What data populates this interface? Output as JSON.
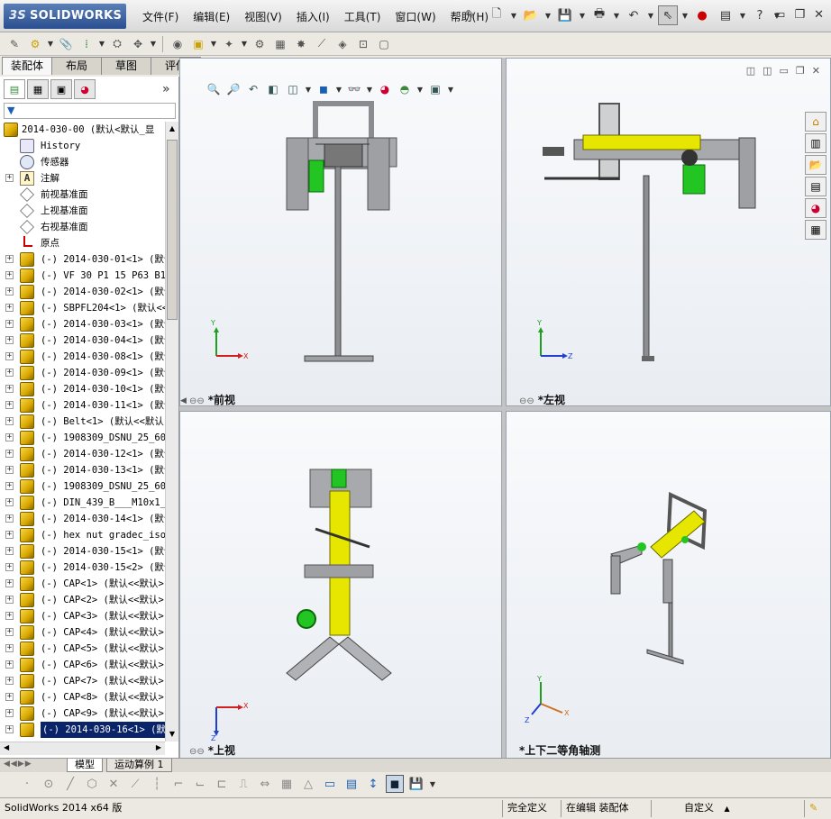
{
  "app": {
    "logo_prefix": "3S",
    "logo_text": "SOLIDWORKS"
  },
  "menu": [
    "文件(F)",
    "编辑(E)",
    "视图(V)",
    "插入(I)",
    "工具(T)",
    "窗口(W)",
    "帮助(H)"
  ],
  "tabs": [
    "装配体",
    "布局",
    "草图",
    "评估"
  ],
  "tree": {
    "filter_icon": "funnel-icon",
    "root": "2014-030-00 (默认<默认_显",
    "fixed_items": [
      {
        "label": "History",
        "icon": "history-icon"
      },
      {
        "label": "传感器",
        "icon": "sensor-icon"
      },
      {
        "label": "注解",
        "icon": "annotation-icon"
      },
      {
        "label": "前视基准面",
        "icon": "plane-icon"
      },
      {
        "label": "上视基准面",
        "icon": "plane-icon"
      },
      {
        "label": "右视基准面",
        "icon": "plane-icon"
      },
      {
        "label": "原点",
        "icon": "origin-icon"
      }
    ],
    "components": [
      "(-) 2014-030-01<1> (默认",
      "(-) VF 30 P1 15 P63 B14",
      "(-) 2014-030-02<1> (默认",
      "(-) SBPFL204<1> (默认<<",
      "(-) 2014-030-03<1> (默认",
      "(-) 2014-030-04<1> (默认",
      "(-) 2014-030-08<1> (默认",
      "(-) 2014-030-09<1> (默认",
      "(-) 2014-030-10<1> (默认",
      "(-) 2014-030-11<1> (默认",
      "(-) Belt<1> (默认<<默认",
      "(-) 1908309_DSNU_25_60_",
      "(-) 2014-030-12<1> (默认",
      "(-) 2014-030-13<1> (默认",
      "(-) 1908309_DSNU_25_60_",
      "(-) DIN_439_B___M10x1_2",
      "(-) 2014-030-14<1> (默认",
      "(-) hex nut gradec_iso_",
      "(-) 2014-030-15<1> (默认",
      "(-) 2014-030-15<2> (默认",
      "(-) CAP<1> (默认<<默认>",
      "(-) CAP<2> (默认<<默认>",
      "(-) CAP<3> (默认<<默认>",
      "(-) CAP<4> (默认<<默认>",
      "(-) CAP<5> (默认<<默认>",
      "(-) CAP<6> (默认<<默认>",
      "(-) CAP<7> (默认<<默认>",
      "(-) CAP<8> (默认<<默认>",
      "(-) CAP<9> (默认<<默认>",
      "(-) 2014-030-16<1> (默认"
    ],
    "selected_index": 29
  },
  "viewports": {
    "front": {
      "label": "*前视",
      "axis_y": "Y",
      "axis_x": "X"
    },
    "left": {
      "label": "*左视",
      "axis_y": "Y",
      "axis_z": "Z"
    },
    "top": {
      "label": "*上视",
      "axis_z": "Z",
      "axis_x": "X"
    },
    "iso": {
      "label": "*上下二等角轴测",
      "axis_y": "Y",
      "axis_x": "X",
      "axis_z": "Z"
    }
  },
  "bottom_tabs": [
    "模型",
    "运动算例 1"
  ],
  "status": {
    "version": "SolidWorks 2014 x64 版",
    "definition": "完全定义",
    "editing": "在编辑 装配体",
    "units": "自定义",
    "units_arrow": "▲"
  },
  "colors": {
    "part_yellow": "#e6e600",
    "green": "#22c522",
    "frame_gray": "#9ea0a4",
    "selection": "#0a246a",
    "axis_x": "#d02020",
    "axis_y": "#20a020",
    "axis_z": "#2040d0"
  }
}
